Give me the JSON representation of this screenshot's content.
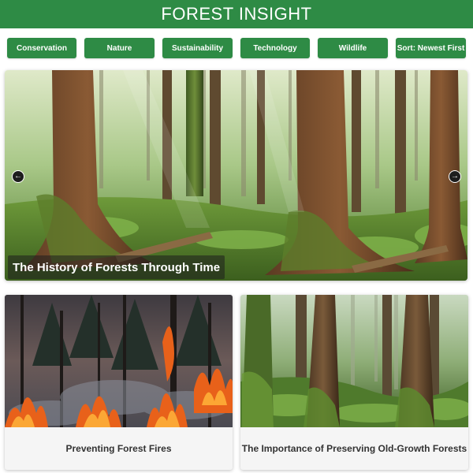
{
  "header": {
    "title": "FOREST INSIGHT"
  },
  "filters": [
    {
      "label": "Conservation"
    },
    {
      "label": "Nature"
    },
    {
      "label": "Sustainability"
    },
    {
      "label": "Technology"
    },
    {
      "label": "Wildlife"
    },
    {
      "label": "Sort: Newest First"
    }
  ],
  "hero": {
    "title": "The History of Forests Through Time",
    "prev_icon": "arrow-left-icon",
    "next_icon": "arrow-right-icon"
  },
  "cards": [
    {
      "title": "Preventing Forest Fires"
    },
    {
      "title": "The Importance of Preserving Old-Growth Forests"
    }
  ],
  "colors": {
    "brand_green": "#2e8b45",
    "card_background": "#f5f5f5",
    "text_dark": "#333333"
  }
}
